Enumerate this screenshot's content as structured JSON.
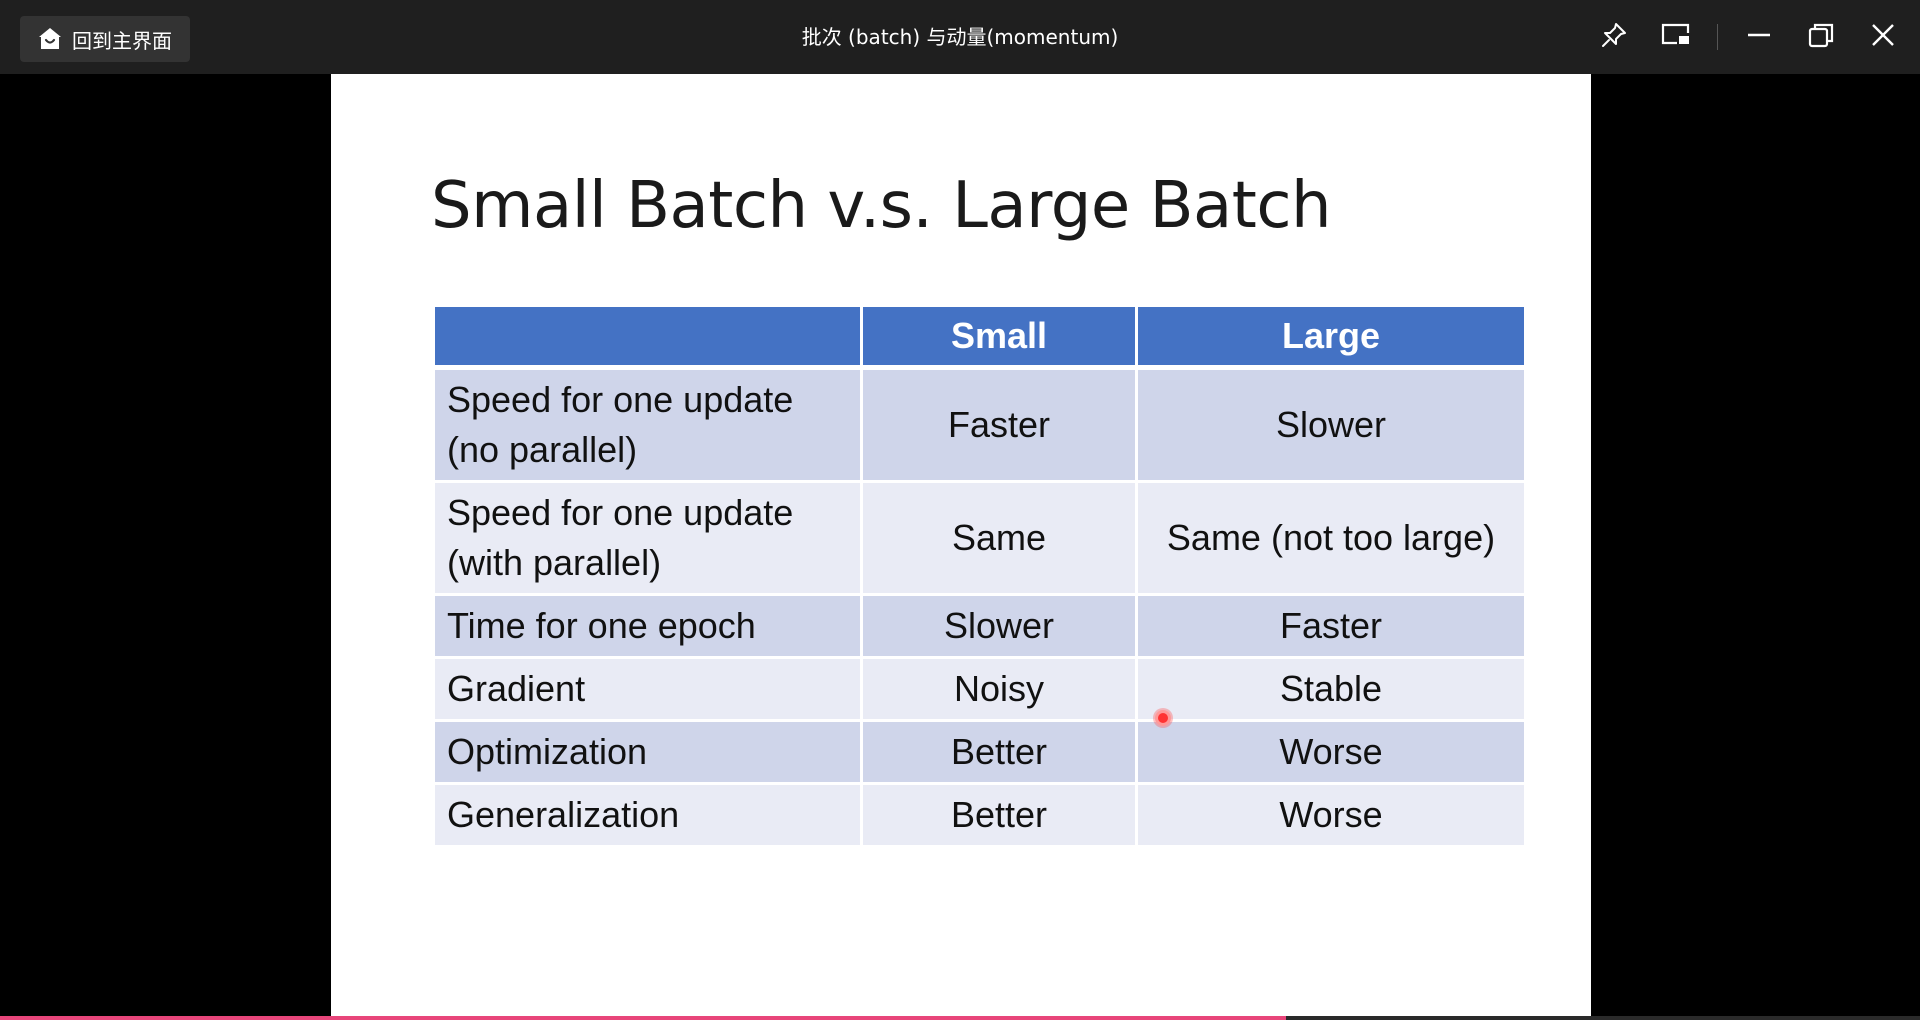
{
  "window": {
    "title": "批次 (batch) 与动量(momentum)",
    "home_label": "回到主界面"
  },
  "controls": {
    "icons": [
      "pin-icon",
      "picture-in-picture-icon",
      "minimize-icon",
      "restore-icon",
      "close-icon"
    ]
  },
  "slide": {
    "title": "Small Batch v.s. Large Batch",
    "table": {
      "headers": [
        "",
        "Small",
        "Large"
      ],
      "rows": [
        {
          "label_line1": "Speed for one update",
          "label_line2": "(no parallel)",
          "small": "Faster",
          "large": "Slower"
        },
        {
          "label_line1": "Speed for one update",
          "label_line2": "(with parallel)",
          "small": "Same",
          "large": "Same (not too large)"
        },
        {
          "label": "Time for one epoch",
          "small": "Slower",
          "large": "Faster"
        },
        {
          "label": "Gradient",
          "small": "Noisy",
          "large": "Stable"
        },
        {
          "label": "Optimization",
          "small": "Better",
          "large": "Worse"
        },
        {
          "label": "Generalization",
          "small": "Better",
          "large": "Worse"
        }
      ]
    }
  },
  "colors": {
    "header_blue": "#4472c4",
    "row_dark": "#cfd5ea",
    "row_light": "#e9ebf5",
    "progress": "#e8457a"
  },
  "progress": {
    "fraction": 0.67
  }
}
